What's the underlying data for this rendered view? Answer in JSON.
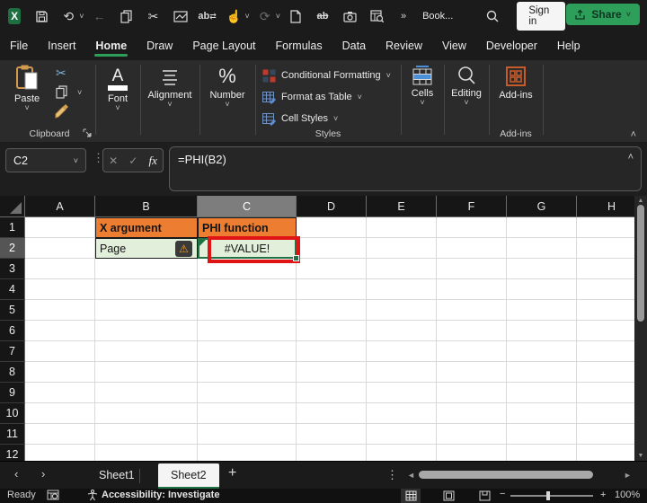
{
  "titlebar": {
    "workbook_title": "Book...",
    "sign_in": "Sign in",
    "overflow_glyph": "»",
    "logo_letter": "X"
  },
  "tabs": {
    "items": [
      {
        "label": "File"
      },
      {
        "label": "Insert"
      },
      {
        "label": "Home"
      },
      {
        "label": "Draw"
      },
      {
        "label": "Page Layout"
      },
      {
        "label": "Formulas"
      },
      {
        "label": "Data"
      },
      {
        "label": "Review"
      },
      {
        "label": "View"
      },
      {
        "label": "Developer"
      },
      {
        "label": "Help"
      }
    ],
    "active_index": 2
  },
  "share": {
    "label": "Share"
  },
  "ribbon": {
    "paste_label": "Paste",
    "clipboard_group": "Clipboard",
    "font_label": "Font",
    "alignment_label": "Alignment",
    "number_label": "Number",
    "styles_items": [
      {
        "label": "Conditional Formatting"
      },
      {
        "label": "Format as Table"
      },
      {
        "label": "Cell Styles"
      }
    ],
    "styles_group": "Styles",
    "cells_label": "Cells",
    "editing_label": "Editing",
    "addins_label": "Add-ins",
    "addins_group": "Add-ins"
  },
  "formula_bar": {
    "name_box": "C2",
    "fx": "fx",
    "formula": "=PHI(B2)"
  },
  "grid": {
    "col_headers": [
      "A",
      "B",
      "C",
      "D",
      "E",
      "F",
      "G",
      "H"
    ],
    "row_headers": [
      "1",
      "2",
      "3",
      "4",
      "5",
      "6",
      "7",
      "8",
      "9",
      "10",
      "11",
      "12"
    ],
    "active_column": "C",
    "active_row": "2",
    "cells": [
      {
        "ref": "B1",
        "text": "X argument",
        "bg": "#ED7D31",
        "bold": true,
        "bordered": true
      },
      {
        "ref": "C1",
        "text": "PHI function",
        "bg": "#ED7D31",
        "bold": true,
        "bordered": true
      },
      {
        "ref": "B2",
        "text": "Page",
        "bg": "#E2EFDA",
        "bordered": true,
        "warning": true
      },
      {
        "ref": "C2",
        "text": "#VALUE!",
        "bg": "#E2EFDA",
        "bordered": true,
        "center": true,
        "selected": true,
        "annotated": true
      }
    ],
    "colors": {
      "header_fill": "#ED7D31",
      "value_fill": "#E2EFDA",
      "selection_green": "#217346",
      "annotation_red": "#E01414"
    }
  },
  "sheets": {
    "items": [
      {
        "label": "Sheet1"
      },
      {
        "label": "Sheet2"
      }
    ],
    "active": "Sheet2"
  },
  "status": {
    "mode": "Ready",
    "accessibility": "Accessibility: Investigate",
    "zoom": "100%"
  }
}
